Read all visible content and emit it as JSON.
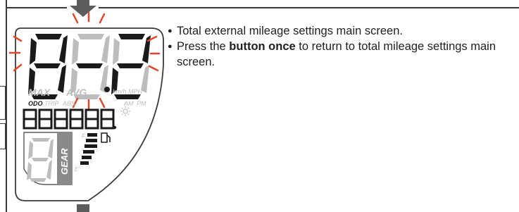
{
  "instructions": {
    "line1": "Total external mileage settings main screen.",
    "line2_pre": "Press the ",
    "line2_bold": "button once",
    "line2_post": " to return to total mileage settings main screen."
  },
  "display": {
    "main_digits": "888",
    "odometer_digits": "888888",
    "labels": {
      "max": "MAX",
      "avg": "AVG",
      "speed_unit": "km/h MPH",
      "odo": "ODO",
      "trip": "TRIP",
      "abs": "ABS",
      "am": "AM",
      "pm": "PM",
      "gear": "GEAR",
      "fuel_full": "F",
      "fuel_empty": "E"
    }
  },
  "icons": {
    "arrow_top": "down-arrow-icon",
    "arrow_bottom": "down-arrow-icon",
    "fuel_pump": "fuel-pump-icon",
    "backlight": "sun-icon",
    "blink": "blink-rays-icon"
  },
  "colors": {
    "segment_on": "#1a1a1a",
    "segment_off": "#bdbdbd",
    "blink_ray": "#e0472a",
    "arrow": "#5c5c5c",
    "gear_panel": "#8a8a8a"
  }
}
